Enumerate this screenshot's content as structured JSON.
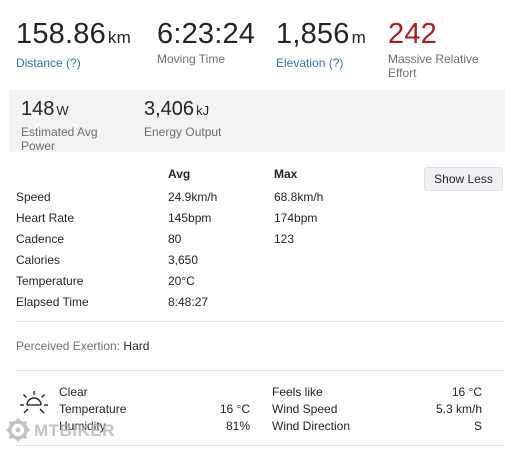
{
  "top_stats": [
    {
      "value": "158.86",
      "unit": "km",
      "label": "Distance (?)"
    },
    {
      "value": "6:23:24",
      "unit": "",
      "label": "Moving Time"
    },
    {
      "value": "1,856",
      "unit": "m",
      "label": "Elevation (?)"
    },
    {
      "value": "242",
      "unit": "",
      "label": "Massive Relative Effort"
    }
  ],
  "secondary_stats": [
    {
      "value": "148",
      "unit": "W",
      "label": "Estimated Avg Power"
    },
    {
      "value": "3,406",
      "unit": "kJ",
      "label": "Energy Output"
    }
  ],
  "details": {
    "avg_header": "Avg",
    "max_header": "Max",
    "show_less_label": "Show Less",
    "rows": [
      {
        "label": "Speed",
        "avg": "24.9km/h",
        "max": "68.8km/h"
      },
      {
        "label": "Heart Rate",
        "avg": "145bpm",
        "max": "174bpm"
      },
      {
        "label": "Cadence",
        "avg": "80",
        "max": "123"
      },
      {
        "label": "Calories",
        "avg": "3,650",
        "max": ""
      },
      {
        "label": "Temperature",
        "avg": "20°C",
        "max": ""
      },
      {
        "label": "Elapsed Time",
        "avg": "8:48:27",
        "max": ""
      }
    ]
  },
  "exertion": {
    "label": "Perceived Exertion:",
    "value": "Hard"
  },
  "weather": {
    "icon": "sun-icon",
    "condition": "Clear",
    "temperature_label": "Temperature",
    "temperature_value": "16 °C",
    "humidity_label": "Humidity",
    "humidity_value": "81%",
    "feels_like_label": "Feels like",
    "feels_like_value": "16 °C",
    "wind_speed_label": "Wind Speed",
    "wind_speed_value": "5.3 km/h",
    "wind_direction_label": "Wind Direction",
    "wind_direction_value": "S"
  },
  "watermark": {
    "text": "MTBIKER"
  },
  "colors": {
    "link": "#2e73b5",
    "effort": "#b2191c",
    "muted": "#6d6d78",
    "panel": "#f3f3f4"
  }
}
